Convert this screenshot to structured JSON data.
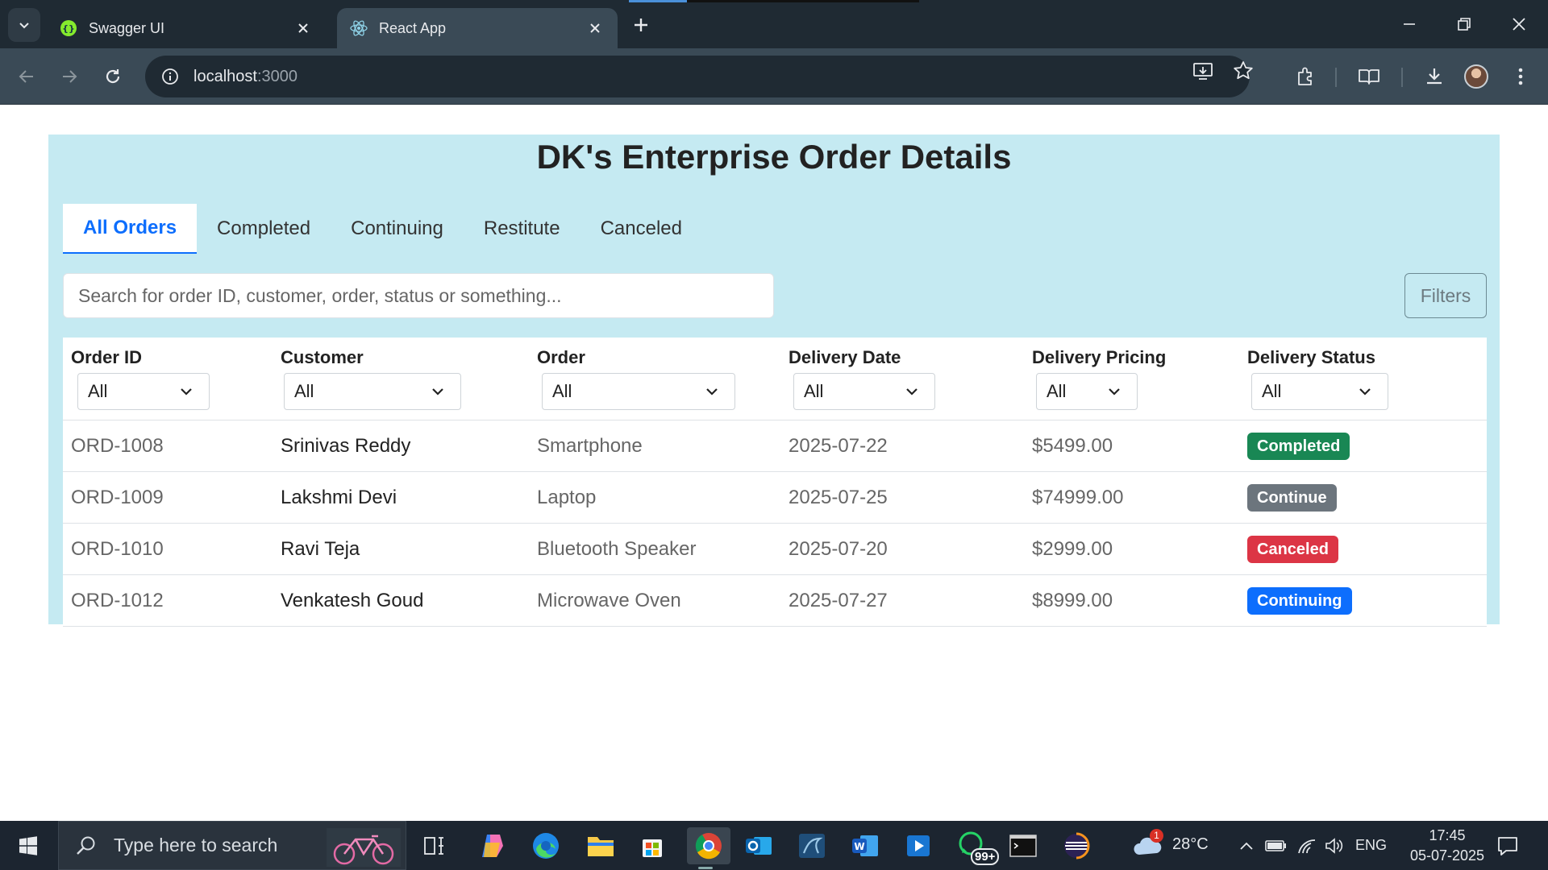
{
  "browser": {
    "tabs": [
      {
        "title": "Swagger UI",
        "active": false,
        "icon": "swagger-icon"
      },
      {
        "title": "React App",
        "active": true,
        "icon": "react-icon"
      }
    ],
    "url_host": "localhost",
    "url_port": ":3000"
  },
  "page": {
    "title": "DK's Enterprise Order Details",
    "tabs": [
      "All Orders",
      "Completed",
      "Continuing",
      "Restitute",
      "Canceled"
    ],
    "active_tab": "All Orders",
    "search_placeholder": "Search for order ID, customer, order, status or something...",
    "filters_label": "Filters"
  },
  "table": {
    "columns": [
      {
        "header": "Order ID",
        "filter": "All"
      },
      {
        "header": "Customer",
        "filter": "All"
      },
      {
        "header": "Order",
        "filter": "All"
      },
      {
        "header": "Delivery Date",
        "filter": "All"
      },
      {
        "header": "Delivery Pricing",
        "filter": "All"
      },
      {
        "header": "Delivery Status",
        "filter": "All"
      }
    ],
    "rows": [
      {
        "order_id": "ORD-1008",
        "customer": "Srinivas Reddy",
        "order": "Smartphone",
        "date": "2025-07-22",
        "price": "$5499.00",
        "status": "Completed",
        "status_color": "#198754"
      },
      {
        "order_id": "ORD-1009",
        "customer": "Lakshmi Devi",
        "order": "Laptop",
        "date": "2025-07-25",
        "price": "$74999.00",
        "status": "Continue",
        "status_color": "#6c757d"
      },
      {
        "order_id": "ORD-1010",
        "customer": "Ravi Teja",
        "order": "Bluetooth Speaker",
        "date": "2025-07-20",
        "price": "$2999.00",
        "status": "Canceled",
        "status_color": "#dc3545"
      },
      {
        "order_id": "ORD-1012",
        "customer": "Venkatesh Goud",
        "order": "Microwave Oven",
        "date": "2025-07-27",
        "price": "$8999.00",
        "status": "Continuing",
        "status_color": "#0d6efd"
      }
    ]
  },
  "taskbar": {
    "search_placeholder": "Type here to search",
    "weather": "28°C",
    "weather_badge": "1",
    "whatsapp_badge": "99+",
    "language": "ENG",
    "time": "17:45",
    "date": "05-07-2025"
  }
}
